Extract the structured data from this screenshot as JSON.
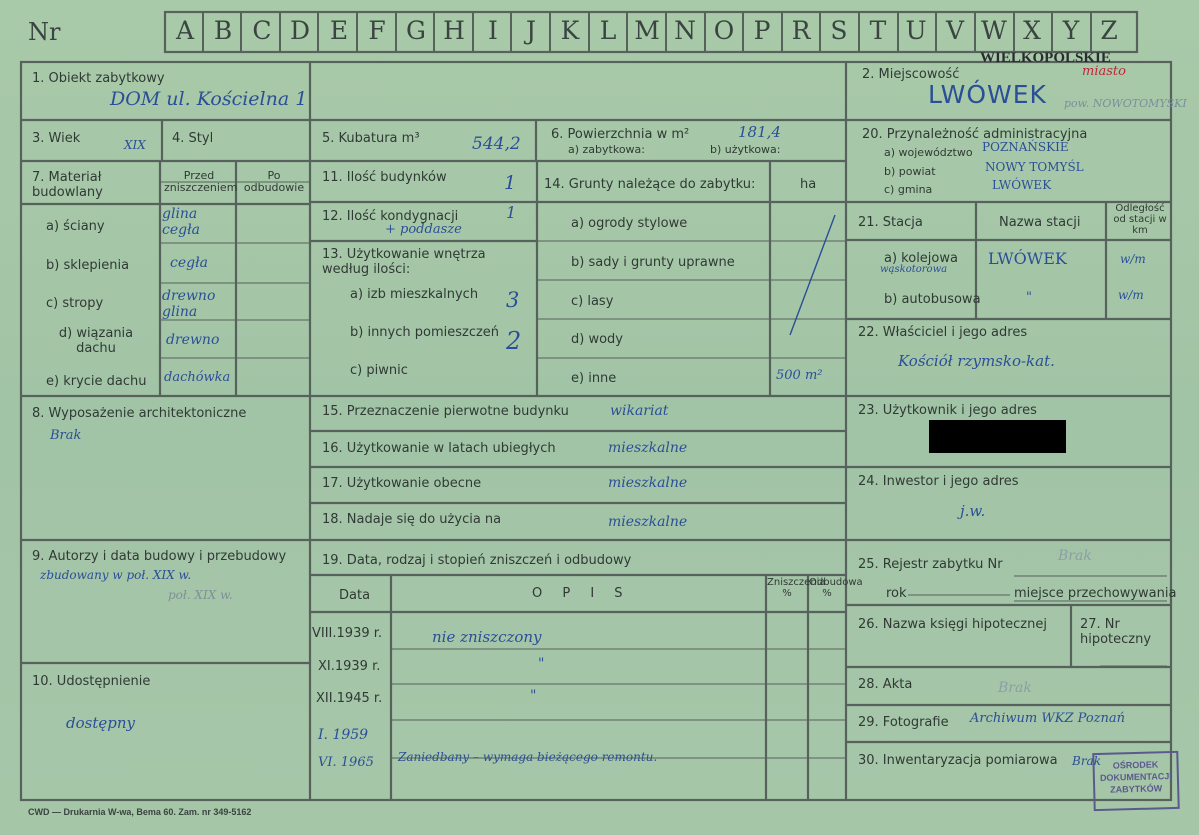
{
  "header": {
    "nr_label": "Nr",
    "letters": [
      "A",
      "B",
      "C",
      "D",
      "E",
      "F",
      "G",
      "H",
      "I",
      "J",
      "K",
      "L",
      "M",
      "N",
      "O",
      "P",
      "R",
      "S",
      "T",
      "U",
      "V",
      "W",
      "X",
      "Y",
      "Z"
    ],
    "region_stamp": "WIELKOPOLSKIE",
    "region_note": "miasto"
  },
  "f1": {
    "label": "1. Obiekt zabytkowy",
    "value": "DOM   ul. Kościelna  1"
  },
  "f2": {
    "label": "2. Miejscowość",
    "value": "LWÓWEK",
    "note": "pow. NOWOTOMYSKI"
  },
  "f3": {
    "label": "3. Wiek",
    "value": "XIX"
  },
  "f4": {
    "label": "4. Styl"
  },
  "f5": {
    "label": "5. Kubatura m³",
    "value": "544,2"
  },
  "f6": {
    "label": "6. Powierzchnia w m²",
    "sub_a": "a) zabytkowa:",
    "sub_b": "b) użytkowa:",
    "value": "181,4"
  },
  "f20": {
    "label": "20. Przynależność administracyjna",
    "a_label": "a) województwo",
    "a_value": "POZNAŃSKIE",
    "b_label": "b) powiat",
    "b_value": "NOWY TOMYŚL",
    "c_label": "c) gmina",
    "c_value": "LWÓWEK"
  },
  "f7": {
    "label": "7. Materiał budowlany",
    "col_before": "Przed zniszczeniem",
    "col_after": "Po odbudowie",
    "rows": [
      {
        "label": "a) ściany",
        "value": "glina cegła"
      },
      {
        "label": "b) sklepienia",
        "value": "cegła"
      },
      {
        "label": "c) stropy",
        "value": "drewno glina"
      },
      {
        "label": "d) wiązania dachu",
        "value": "drewno"
      },
      {
        "label": "e) krycie dachu",
        "value": "dachówka"
      }
    ]
  },
  "f11": {
    "label": "11. Ilość budynków",
    "value": "1"
  },
  "f12": {
    "label": "12. Ilość kondygnacji",
    "value": "1",
    "note": "+ poddasze"
  },
  "f13": {
    "label": "13. Użytkowanie wnętrza według ilości:",
    "a_label": "a) izb mieszkalnych",
    "a_value": "3",
    "b_label": "b) innych pomieszczeń",
    "b_value": "2",
    "c_label": "c) piwnic"
  },
  "f14": {
    "label": "14. Grunty należące do zabytku:",
    "unit": "ha",
    "rows": [
      "a) ogrody stylowe",
      "b) sady i grunty uprawne",
      "c) lasy",
      "d) wody",
      "e) inne"
    ],
    "e_value": "500 m²"
  },
  "f21": {
    "label": "21. Stacja",
    "col_name": "Nazwa stacji",
    "col_dist": "Odległość od stacji w km",
    "a_label": "a) kolejowa",
    "a_note": "wąskotorowa",
    "a_value": "LWÓWEK",
    "a_dist": "w/m",
    "b_label": "b) autobusowa",
    "b_value": "\"",
    "b_dist": "w/m"
  },
  "f22": {
    "label": "22. Właściciel i jego adres",
    "value": "Kościół rzymsko-kat."
  },
  "f8": {
    "label": "8. Wyposażenie architektoniczne",
    "value": "Brak"
  },
  "f15": {
    "label": "15. Przeznaczenie pierwotne budynku",
    "value": "wikariat"
  },
  "f16": {
    "label": "16. Użytkowanie w latach ubiegłych",
    "value": "mieszkalne"
  },
  "f17": {
    "label": "17. Użytkowanie obecne",
    "value": "mieszkalne"
  },
  "f18": {
    "label": "18. Nadaje się do użycia na",
    "value": "mieszkalne"
  },
  "f23": {
    "label": "23. Użytkownik i jego adres"
  },
  "f24": {
    "label": "24. Inwestor i jego adres",
    "value": "j.w."
  },
  "f9": {
    "label": "9. Autorzy i data budowy i przebudowy",
    "value": "zbudowany w poł. XIX w.",
    "pencil": "poł. XIX w."
  },
  "f19": {
    "label": "19. Data, rodzaj i stopień zniszczeń i odbudowy",
    "col_date": "Data",
    "col_desc": "O P I S",
    "col_destr": "Zniszczenia %",
    "col_rebuild": "Odbudowa %",
    "rows": [
      {
        "date": "VIII.1939 r.",
        "desc": "nie zniszczony"
      },
      {
        "date": "XI.1939 r.",
        "desc": "\""
      },
      {
        "date": "XII.1945 r.",
        "desc": "\""
      },
      {
        "date": "I. 1959",
        "desc": ""
      },
      {
        "date": "VI. 1965",
        "desc": "Zaniedbany – wymaga bieżącego remontu."
      }
    ]
  },
  "f25": {
    "label": "25. Rejestr zabytku Nr",
    "value": "Brak",
    "rok_label": "rok",
    "place_label": "miejsce przechowywania"
  },
  "f26": {
    "label": "26. Nazwa księgi hipotecznej"
  },
  "f27": {
    "label": "27. Nr hipoteczny"
  },
  "f10": {
    "label": "10. Udostępnienie",
    "value": "dostępny"
  },
  "f28": {
    "label": "28. Akta",
    "value": "Brak"
  },
  "f29": {
    "label": "29. Fotografie",
    "value": "Archiwum WKZ Poznań"
  },
  "f30": {
    "label": "30. Inwentaryzacja pomiarowa",
    "value": "Brak"
  },
  "footer": {
    "printer": "CWD — Drukarnia W-wa, Bema 60. Zam. nr 349-5162"
  },
  "stamp": {
    "line1": "OŚRODEK",
    "line2": "DOKUMENTACJI",
    "line3": "ZABYTKÓW"
  }
}
